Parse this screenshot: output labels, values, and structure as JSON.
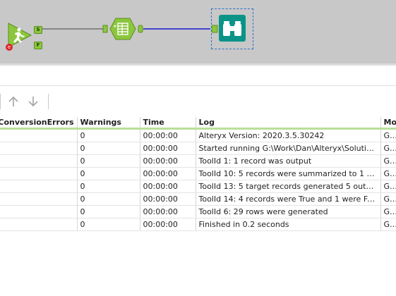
{
  "canvas": {
    "input_anchor_s": "S",
    "input_anchor_f": "F",
    "error_badge": "e",
    "tools": [
      "runner-tool",
      "summarize-tool",
      "browse-tool"
    ]
  },
  "toolbar": {
    "move_up_label": "",
    "move_down_label": ""
  },
  "results": {
    "columns": [
      "ConversionErrors",
      "Warnings",
      "Time",
      "Log",
      "Mo"
    ],
    "rows": [
      [
        "",
        "0",
        "00:00:00",
        "Alteryx Version: 2020.3.5.30242",
        "G:\\V"
      ],
      [
        "",
        "0",
        "00:00:00",
        "Started running G:\\Work\\Dan\\Alteryx\\Solutions\\S...",
        "G:\\V"
      ],
      [
        "",
        "0",
        "00:00:00",
        "ToolId 1: 1 record was output",
        "G:\\V"
      ],
      [
        "",
        "0",
        "00:00:00",
        "ToolId 10: 5 records were summarized to 1 groups",
        "G:\\V"
      ],
      [
        "",
        "0",
        "00:00:00",
        "ToolId 13: 5 target records generated 5 output re...",
        "G:\\V"
      ],
      [
        "",
        "0",
        "00:00:00",
        "ToolId 14: 4 records were True and 1 were False",
        "G:\\V"
      ],
      [
        "",
        "0",
        "00:00:00",
        "ToolId 6: 29 rows were generated",
        "G:\\V"
      ],
      [
        "",
        "0",
        "00:00:00",
        "Finished in 0.2 seconds",
        "G:\\V"
      ]
    ]
  },
  "colors": {
    "canvas_bg": "#c8c8c8",
    "tool_green": "#8cc63f",
    "browse_teal": "#0a9488",
    "connection_blue": "#1515d0",
    "header_underline": "#b9df9a"
  }
}
